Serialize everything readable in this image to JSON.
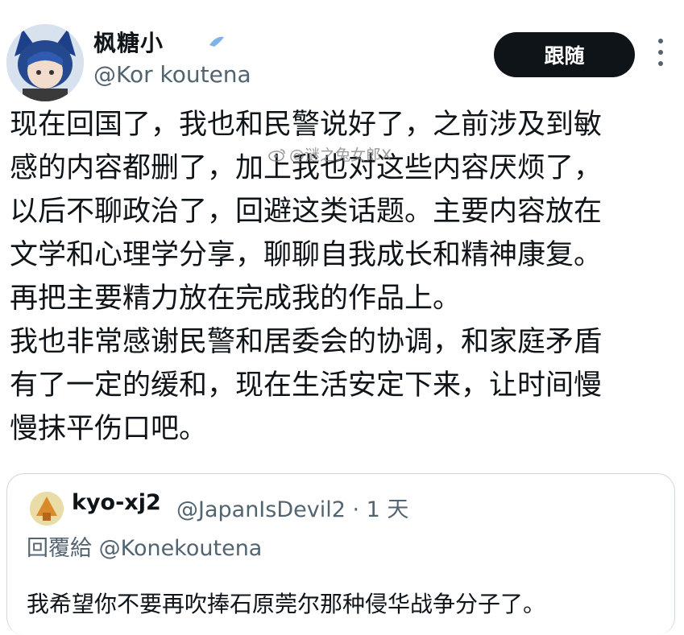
{
  "author": {
    "display_name": "枫糖小",
    "handle": "@Kor  koutena"
  },
  "follow_label": "跟随",
  "tweet": {
    "lines": [
      "现在回国了，我也和民警说好了，之前涉及到敏",
      "感的内容都删了，加上我也对这些内容厌烦了，",
      "以后不聊政治了，回避这类话题。主要内容放在",
      "文学和心理学分享，聊聊自我成长和精神康复。",
      "再把主要精力放在完成我的作品上。",
      "我也非常感谢民警和居委会的协调，和家庭矛盾",
      "有了一定的缓和，现在生活安定下来，让时间慢",
      "慢抹平伤口吧。"
    ]
  },
  "watermark": "@谜之兔女郎X",
  "quote": {
    "name": "kyo-xj2",
    "meta": "@JapanIsDevil2 · 1 天",
    "reply_to": "回覆給 @Konekoutena",
    "text": "我希望你不要再吹捧石原莞尔那种侵华战争分子了。"
  },
  "icons": {
    "verified": "verified-badge-icon",
    "more": "more-vertical-icon",
    "watermark": "weibo-icon"
  },
  "colors": {
    "button_bg": "#0f1419",
    "secondary_text": "#536471",
    "border": "#cfd9de"
  }
}
